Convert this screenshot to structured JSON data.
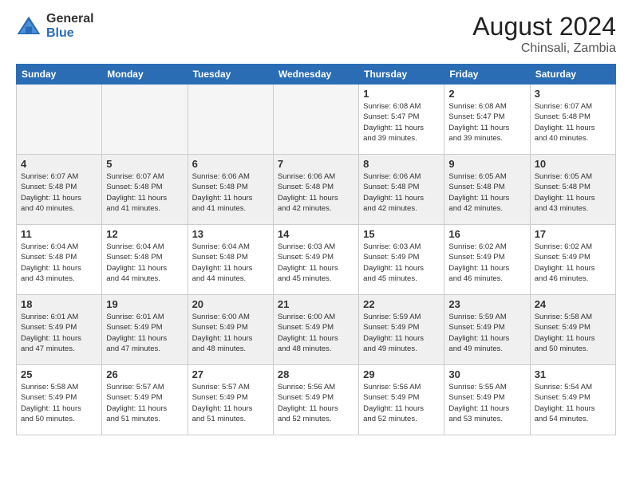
{
  "logo": {
    "general": "General",
    "blue": "Blue"
  },
  "title": "August 2024",
  "location": "Chinsali, Zambia",
  "days_of_week": [
    "Sunday",
    "Monday",
    "Tuesday",
    "Wednesday",
    "Thursday",
    "Friday",
    "Saturday"
  ],
  "weeks": [
    [
      {
        "day": "",
        "info": "",
        "empty": true
      },
      {
        "day": "",
        "info": "",
        "empty": true
      },
      {
        "day": "",
        "info": "",
        "empty": true
      },
      {
        "day": "",
        "info": "",
        "empty": true
      },
      {
        "day": "1",
        "info": "Sunrise: 6:08 AM\nSunset: 5:47 PM\nDaylight: 11 hours\nand 39 minutes."
      },
      {
        "day": "2",
        "info": "Sunrise: 6:08 AM\nSunset: 5:47 PM\nDaylight: 11 hours\nand 39 minutes."
      },
      {
        "day": "3",
        "info": "Sunrise: 6:07 AM\nSunset: 5:48 PM\nDaylight: 11 hours\nand 40 minutes."
      }
    ],
    [
      {
        "day": "4",
        "info": "Sunrise: 6:07 AM\nSunset: 5:48 PM\nDaylight: 11 hours\nand 40 minutes."
      },
      {
        "day": "5",
        "info": "Sunrise: 6:07 AM\nSunset: 5:48 PM\nDaylight: 11 hours\nand 41 minutes."
      },
      {
        "day": "6",
        "info": "Sunrise: 6:06 AM\nSunset: 5:48 PM\nDaylight: 11 hours\nand 41 minutes."
      },
      {
        "day": "7",
        "info": "Sunrise: 6:06 AM\nSunset: 5:48 PM\nDaylight: 11 hours\nand 42 minutes."
      },
      {
        "day": "8",
        "info": "Sunrise: 6:06 AM\nSunset: 5:48 PM\nDaylight: 11 hours\nand 42 minutes."
      },
      {
        "day": "9",
        "info": "Sunrise: 6:05 AM\nSunset: 5:48 PM\nDaylight: 11 hours\nand 42 minutes."
      },
      {
        "day": "10",
        "info": "Sunrise: 6:05 AM\nSunset: 5:48 PM\nDaylight: 11 hours\nand 43 minutes."
      }
    ],
    [
      {
        "day": "11",
        "info": "Sunrise: 6:04 AM\nSunset: 5:48 PM\nDaylight: 11 hours\nand 43 minutes."
      },
      {
        "day": "12",
        "info": "Sunrise: 6:04 AM\nSunset: 5:48 PM\nDaylight: 11 hours\nand 44 minutes."
      },
      {
        "day": "13",
        "info": "Sunrise: 6:04 AM\nSunset: 5:48 PM\nDaylight: 11 hours\nand 44 minutes."
      },
      {
        "day": "14",
        "info": "Sunrise: 6:03 AM\nSunset: 5:49 PM\nDaylight: 11 hours\nand 45 minutes."
      },
      {
        "day": "15",
        "info": "Sunrise: 6:03 AM\nSunset: 5:49 PM\nDaylight: 11 hours\nand 45 minutes."
      },
      {
        "day": "16",
        "info": "Sunrise: 6:02 AM\nSunset: 5:49 PM\nDaylight: 11 hours\nand 46 minutes."
      },
      {
        "day": "17",
        "info": "Sunrise: 6:02 AM\nSunset: 5:49 PM\nDaylight: 11 hours\nand 46 minutes."
      }
    ],
    [
      {
        "day": "18",
        "info": "Sunrise: 6:01 AM\nSunset: 5:49 PM\nDaylight: 11 hours\nand 47 minutes."
      },
      {
        "day": "19",
        "info": "Sunrise: 6:01 AM\nSunset: 5:49 PM\nDaylight: 11 hours\nand 47 minutes."
      },
      {
        "day": "20",
        "info": "Sunrise: 6:00 AM\nSunset: 5:49 PM\nDaylight: 11 hours\nand 48 minutes."
      },
      {
        "day": "21",
        "info": "Sunrise: 6:00 AM\nSunset: 5:49 PM\nDaylight: 11 hours\nand 48 minutes."
      },
      {
        "day": "22",
        "info": "Sunrise: 5:59 AM\nSunset: 5:49 PM\nDaylight: 11 hours\nand 49 minutes."
      },
      {
        "day": "23",
        "info": "Sunrise: 5:59 AM\nSunset: 5:49 PM\nDaylight: 11 hours\nand 49 minutes."
      },
      {
        "day": "24",
        "info": "Sunrise: 5:58 AM\nSunset: 5:49 PM\nDaylight: 11 hours\nand 50 minutes."
      }
    ],
    [
      {
        "day": "25",
        "info": "Sunrise: 5:58 AM\nSunset: 5:49 PM\nDaylight: 11 hours\nand 50 minutes."
      },
      {
        "day": "26",
        "info": "Sunrise: 5:57 AM\nSunset: 5:49 PM\nDaylight: 11 hours\nand 51 minutes."
      },
      {
        "day": "27",
        "info": "Sunrise: 5:57 AM\nSunset: 5:49 PM\nDaylight: 11 hours\nand 51 minutes."
      },
      {
        "day": "28",
        "info": "Sunrise: 5:56 AM\nSunset: 5:49 PM\nDaylight: 11 hours\nand 52 minutes."
      },
      {
        "day": "29",
        "info": "Sunrise: 5:56 AM\nSunset: 5:49 PM\nDaylight: 11 hours\nand 52 minutes."
      },
      {
        "day": "30",
        "info": "Sunrise: 5:55 AM\nSunset: 5:49 PM\nDaylight: 11 hours\nand 53 minutes."
      },
      {
        "day": "31",
        "info": "Sunrise: 5:54 AM\nSunset: 5:49 PM\nDaylight: 11 hours\nand 54 minutes."
      }
    ]
  ]
}
